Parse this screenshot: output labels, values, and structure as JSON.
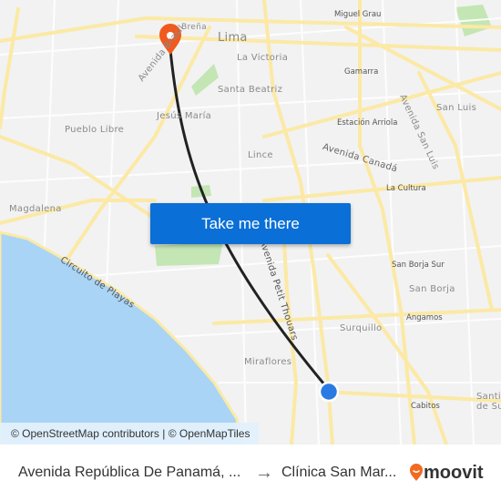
{
  "map": {
    "labels": [
      "Miguel Grau",
      "Lima",
      "La Victoria",
      "Gamarra",
      "Santa Beatriz",
      "Avenida Brasil",
      "Jesús María",
      "San Luis",
      "Estación Arriola",
      "Avenida San Luis",
      "Pueblo Libre",
      "Lince",
      "Avenida Canadá",
      "La Cultura",
      "Magdalena",
      "Circuito de Playas",
      "Avenida Petit Thouars",
      "San Borja Sur",
      "San Borja",
      "Angamos",
      "Surquillo",
      "Miraflores",
      "Cabitos",
      "Santiago de Surco",
      "Breña"
    ],
    "colors": {
      "sea": "#a9d4f5",
      "road": "#fbe9a5",
      "park": "#b9e4a8",
      "route": "#222222",
      "pin": "#f05a1e",
      "origin": "#2a7ae4"
    }
  },
  "cta": {
    "label": "Take me there"
  },
  "attribution": "© OpenStreetMap contributors | © OpenMapTiles",
  "footer": {
    "from": "Avenida República De Panamá, ...",
    "arrow": "→",
    "to": "Clínica San Mar...",
    "brand": "moovit"
  }
}
